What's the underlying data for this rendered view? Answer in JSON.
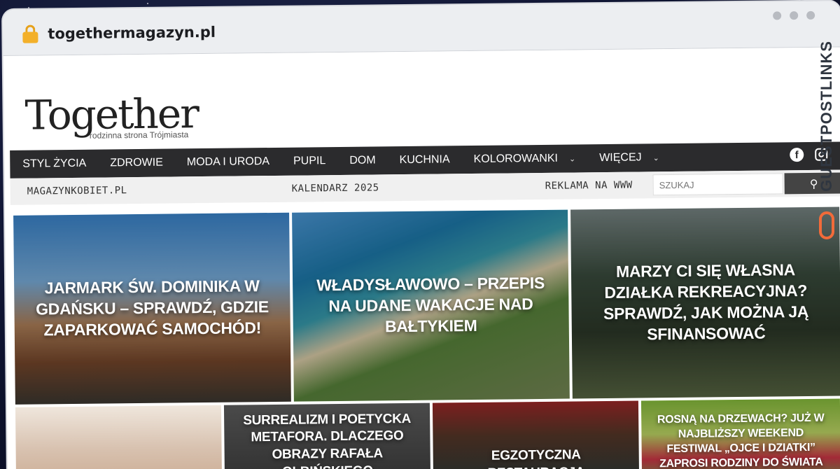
{
  "browser": {
    "url": "togethermagazyn.pl"
  },
  "logo": {
    "word": "Together",
    "tagline": "rodzinna strona Trójmiasta"
  },
  "nav": {
    "items": [
      "STYL ŻYCIA",
      "ZDROWIE",
      "MODA I URODA",
      "PUPIL",
      "DOM",
      "KUCHNIA",
      "KOLOROWANKI",
      "WIĘCEJ"
    ],
    "social": {
      "facebook": "f"
    }
  },
  "subnav": {
    "left": "MAGAZYNKOBIET.PL",
    "center": "KALENDARZ 2025",
    "right": "REKLAMA NA WWW",
    "search_placeholder": "SZUKAJ"
  },
  "featured": [
    {
      "title": "JARMARK ŚW. DOMINIKA W GDAŃSKU – SPRAWDŹ, GDZIE ZAPARKOWAĆ SAMOCHÓD!"
    },
    {
      "title": "WŁADYSŁAWOWO – PRZEPIS NA UDANE WAKACJE NAD BAŁTYKIEM"
    },
    {
      "title": "MARZY CI SIĘ WŁASNA DZIAŁKA REKREACYJNA? SPRAWDŹ, JAK MOŻNA JĄ SFINANSOWAĆ"
    }
  ],
  "secondary": [
    {
      "title": ""
    },
    {
      "title": "SURREALIZM I POETYCKA METAFORA. DLACZEGO OBRAZY RAFAŁA OLBIŃSKIEGO"
    },
    {
      "title": "EGZOTYCZNA RESTAURACJA"
    },
    {
      "title": "ROSNĄ NA DRZEWACH? JUŻ W NAJBLIŻSZY WEEKEND FESTIWAL „OJCE I DZIATKI” ZAPROSI RODZINY DO ŚWIATA"
    }
  ],
  "badge": {
    "text": "GUESTPOSTLINKS"
  }
}
